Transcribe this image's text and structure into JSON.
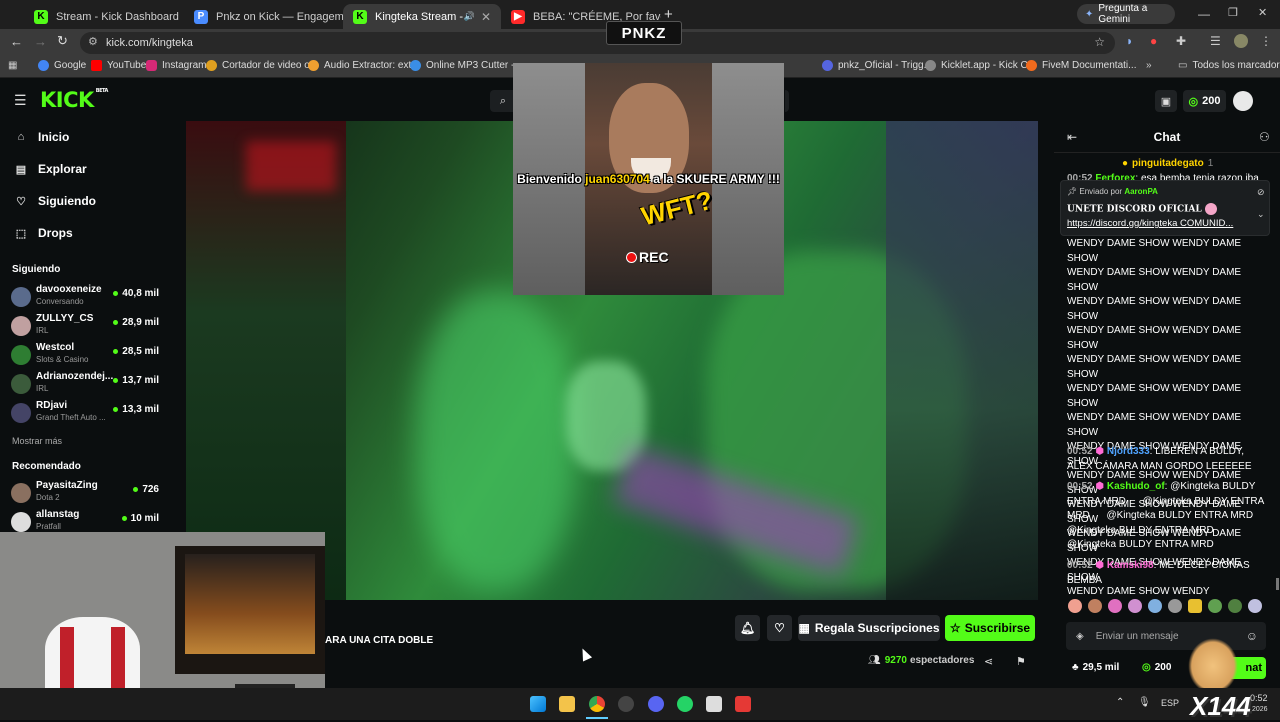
{
  "browser": {
    "tabs": [
      {
        "label": "Stream - Kick Dashboard",
        "fav": "K",
        "color": "#53fc18"
      },
      {
        "label": "Pnkz on Kick — Engagement A",
        "fav": "P",
        "color": "#4a8cff"
      },
      {
        "label": "Kingteka Stream - Watch Li",
        "fav": "K",
        "color": "#53fc18"
      },
      {
        "label": "BEBA: \"CRÉEME, Por favor\"",
        "fav": "▶",
        "color": "#ff2a2a"
      }
    ],
    "gemini_label": "Pregunta a Gemini",
    "url": "kick.com/kingteka",
    "bookmarks": [
      "Google",
      "YouTube",
      "Instagram",
      "Cortador de video o...",
      "Audio Extractor: ext...",
      "Online MP3 Cutter -...",
      "pnkz_Oficial - Trigg...",
      "Kicklet.app - Kick C...",
      "FiveM Documentati..."
    ],
    "all_bookmarks": "Todos los marcadores"
  },
  "header": {
    "logo": "KICK",
    "beta": "BETA",
    "points": "200"
  },
  "sidebar": {
    "nav": [
      {
        "label": "Inicio",
        "icon": "home-icon"
      },
      {
        "label": "Explorar",
        "icon": "explore-icon"
      },
      {
        "label": "Siguiendo",
        "icon": "heart-icon"
      },
      {
        "label": "Drops",
        "icon": "drops-icon"
      }
    ],
    "following_title": "Siguiendo",
    "following": [
      {
        "name": "davooxeneize",
        "game": "Conversando",
        "viewers": "40,8 mil",
        "color": "#5a6b8c"
      },
      {
        "name": "ZULLYY_CS",
        "game": "IRL",
        "viewers": "28,9 mil",
        "color": "#c0a0a0"
      },
      {
        "name": "Westcol",
        "game": "Slots & Casino",
        "viewers": "28,5 mil",
        "color": "#2e7d32"
      },
      {
        "name": "Adrianozendej...",
        "game": "IRL",
        "viewers": "13,7 mil",
        "color": "#3b5b3b"
      },
      {
        "name": "RDjavi",
        "game": "Grand Theft Auto ...",
        "viewers": "13,3 mil",
        "color": "#444466"
      }
    ],
    "show_more": "Mostrar más",
    "recommended_title": "Recomendado",
    "recommended": [
      {
        "name": "PayasitaZing",
        "game": "Dota 2",
        "viewers": "726",
        "color": "#8a7060"
      },
      {
        "name": "allanstag",
        "game": "Pratfall",
        "viewers": "10 mil",
        "color": "#dddddd"
      }
    ]
  },
  "overlay": {
    "brand": "PNKZ",
    "welcome_pre": "Bienvenido",
    "welcome_user": "juan630704",
    "welcome_post": "a la SKUERE ARMY !!!",
    "wtf": "WFT?",
    "rec": "REC"
  },
  "stream": {
    "title_partial": "ARA UNA CITA DOBLE",
    "gift_label": "Regala Suscripciones",
    "subscribe_label": "Suscribirse",
    "viewers": "9270",
    "viewers_label": "espectadores"
  },
  "chat": {
    "title": "Chat",
    "top_gifter": "pinguitadegato",
    "top_gifter_count": "1",
    "first_msg_time": "00:52",
    "first_msg_user": "Ferforex",
    "first_msg_text": "esa bemba tenia razon iba a",
    "pinned_by_prefix": "Enviado por",
    "pinned_by": "AaronPA",
    "pinned_title": "UNETE DISCORD OFICIAL",
    "pinned_link": "https://discord.gg/kingteka COMUNID...",
    "spam_lines": [
      "WENDY DAME SHOW WENDY DAME SHOW",
      "WENDY DAME SHOW WENDY DAME SHOW",
      "WENDY DAME SHOW WENDY DAME SHOW",
      "WENDY DAME SHOW WENDY DAME SHOW",
      "WENDY DAME SHOW WENDY DAME SHOW",
      "WENDY DAME SHOW WENDY DAME SHOW",
      "WENDY DAME SHOW WENDY DAME SHOW",
      "WENDY DAME SHOW WENDY DAME SHOW",
      "WENDY DAME SHOW WENDY DAME SHOW",
      "WENDY DAME SHOW WENDY DAME SHOW",
      "WENDY DAME SHOW WENDY DAME SHOW",
      "WENDY DAME SHOW WENDY DAME SHOW",
      "WENDY DAME SHOW WENDY"
    ],
    "messages": [
      {
        "time": "00:52",
        "user": "Njord333",
        "text": "LIBEREN A BULDY, ALEX CÁMARA MAN GORDO LEEEEEE",
        "color": "#4fa3ff"
      },
      {
        "time": "00:52",
        "user": "Kashudo_of",
        "text": "@Kingteka BULDY ENTRA MRD      @Kingteka BULDY ENTRA MRD      @Kingteka BULDY ENTRA MRD      @Kingteka BULDY ENTRA MRD      @Kingteka BULDY ENTRA MRD",
        "color": "#53fc18"
      },
      {
        "time": "00:52",
        "user": "Kamski98",
        "text": "ME DECEPCIONAS BEMBA",
        "color": "#ff6bd5"
      }
    ],
    "input_placeholder": "Enviar un mensaje",
    "points": "29,5 mil",
    "points2": "200",
    "chat_btn": "nat"
  },
  "taskbar": {
    "lang": "ESP",
    "time": "0:52",
    "date": "2026",
    "watermark": "X144"
  }
}
